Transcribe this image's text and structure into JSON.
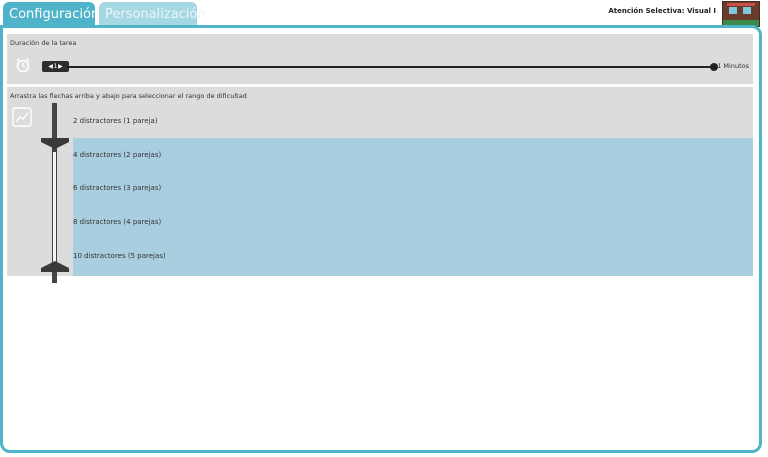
{
  "tabs": [
    {
      "label": "Configuración",
      "active": true
    },
    {
      "label": "Personalización",
      "active": false
    }
  ],
  "header": {
    "title": "Atención Selectiva: Visual I"
  },
  "duration": {
    "label": "Duración de la tarea",
    "value": "1",
    "unit_label": "1 Minutos"
  },
  "difficulty": {
    "instruction": "Arrastra las flechas arriba y abajo para seleccionar el rango de dificultad",
    "options": [
      "2 distractores (1 pareja)",
      "4 distractores (2 parejas)",
      "6 distractores (3 parejas)",
      "8 distractores (4 parejas)",
      "10 distractores (5 parejas)"
    ],
    "selected_range": [
      "4 distractores (2 parejas)",
      "10 distractores (5 parejas)"
    ]
  },
  "colors": {
    "accent": "#4fb3c9",
    "selection": "#a9cee0",
    "panel": "#dcdcdc"
  },
  "icons": [
    "alarm-clock-icon",
    "chart-icon",
    "arrow-left-icon",
    "arrow-right-icon"
  ]
}
